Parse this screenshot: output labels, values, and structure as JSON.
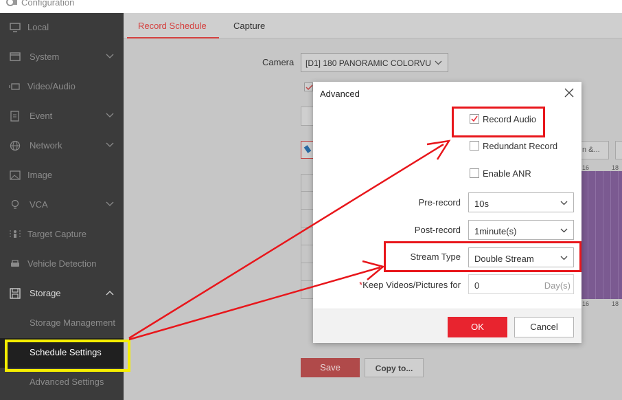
{
  "header": {
    "title": "Configuration",
    "icon": "gear-camera-icon"
  },
  "sidebar": {
    "items": [
      {
        "label": "Local",
        "icon": "monitor-icon"
      },
      {
        "label": "System",
        "icon": "window-icon"
      },
      {
        "label": "Video/Audio",
        "icon": "video-icon"
      },
      {
        "label": "Event",
        "icon": "clipboard-icon"
      },
      {
        "label": "Network",
        "icon": "globe-icon"
      },
      {
        "label": "Image",
        "icon": "image-icon"
      },
      {
        "label": "VCA",
        "icon": "bulb-icon"
      },
      {
        "label": "Target Capture",
        "icon": "person-target-icon"
      },
      {
        "label": "Vehicle Detection",
        "icon": "car-icon"
      },
      {
        "label": "Storage",
        "icon": "floppy-icon"
      }
    ],
    "storage_sub": [
      {
        "label": "Storage Management"
      },
      {
        "label": "Schedule Settings"
      },
      {
        "label": "Advanced Settings"
      }
    ]
  },
  "tabs": [
    {
      "label": "Record Schedule"
    },
    {
      "label": "Capture"
    }
  ],
  "main": {
    "camera_label": "Camera",
    "camera_value": "[D1] 180 PANORAMIC COLORVU",
    "right_button_partial": "n &...",
    "tick_16": "16",
    "tick_18": "18",
    "save_label": "Save",
    "copy_label": "Copy to..."
  },
  "dialog": {
    "title": "Advanced",
    "record_audio": {
      "label": "Record Audio",
      "checked": true
    },
    "redundant_record": {
      "label": "Redundant Record",
      "checked": false
    },
    "enable_anr": {
      "label": "Enable ANR",
      "checked": false
    },
    "pre_record": {
      "label": "Pre-record",
      "value": "10s"
    },
    "post_record": {
      "label": "Post-record",
      "value": "1minute(s)"
    },
    "stream_type": {
      "label": "Stream Type",
      "value": "Double Stream"
    },
    "keep_videos": {
      "required_mark": "*",
      "label": "Keep Videos/Pictures for",
      "value": "0",
      "unit": "Day(s)"
    },
    "ok_label": "OK",
    "cancel_label": "Cancel"
  },
  "colors": {
    "sidebar_bg": "#3b3b3b",
    "accent_red": "#e8242f",
    "annotation_red": "#e8161b",
    "annotation_yellow": "#f5ee00",
    "schedule_purple": "#7b5a91"
  }
}
